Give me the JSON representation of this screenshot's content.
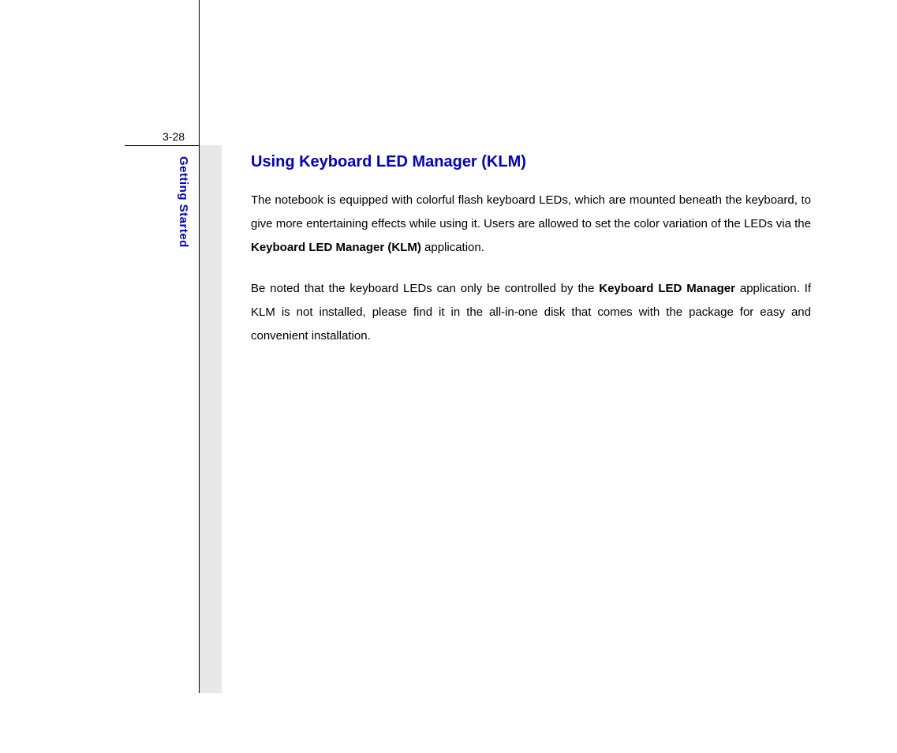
{
  "page_number": "3-28",
  "side_label": "Getting Started",
  "heading": "Using Keyboard LED Manager (KLM)",
  "para1_a": "The notebook is equipped with colorful flash keyboard LEDs, which are mounted beneath the keyboard, to give more entertaining effects while using it.   Users are allowed to set the color variation of the LEDs via the ",
  "para1_bold": "Keyboard LED Manager (KLM)",
  "para1_b": " application.",
  "para2_a": "Be noted that the keyboard LEDs can only be controlled by the ",
  "para2_bold": "Keyboard LED Manager",
  "para2_b": " application. If KLM is not installed, please find it in the all-in-one disk that comes with the package for easy and convenient installation."
}
